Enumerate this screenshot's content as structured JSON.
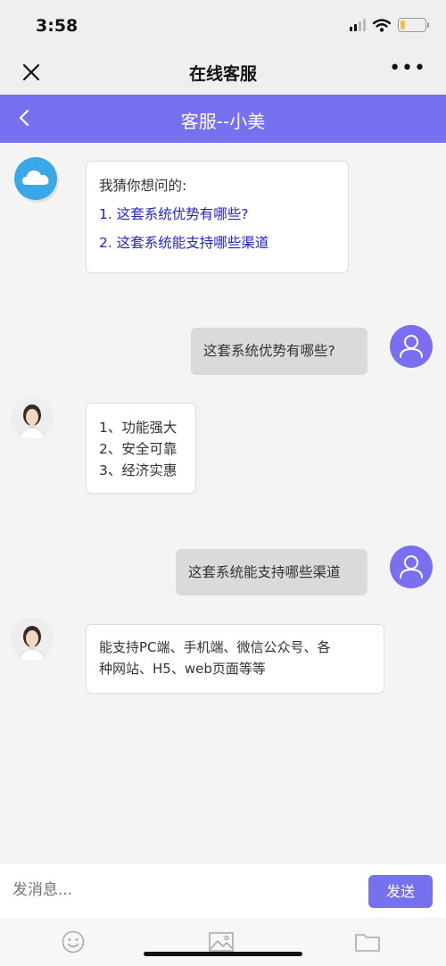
{
  "status": {
    "time": "3:58"
  },
  "nav": {
    "title": "在线客服",
    "more": "•••"
  },
  "chat": {
    "title": "客服--小美"
  },
  "messages": [
    {
      "from": "bot",
      "intro": "我猜你想问的:",
      "options": [
        "1.  这套系统优势有哪些?",
        "2.  这套系统能支持哪些渠道"
      ]
    },
    {
      "from": "user",
      "text": "这套系统优势有哪些?"
    },
    {
      "from": "agent",
      "lines": [
        "1、功能强大",
        "2、安全可靠",
        "3、经济实惠"
      ]
    },
    {
      "from": "user",
      "text": "这套系统能支持哪些渠道"
    },
    {
      "from": "agent",
      "lines": [
        "能支持PC端、手机端、微信公众号、各",
        "种网站、H5、web页面等等"
      ]
    }
  ],
  "input": {
    "placeholder": "发消息...",
    "send_label": "发送"
  },
  "toolbar": {
    "icons": [
      "smiley-icon",
      "image-icon",
      "folder-icon"
    ]
  },
  "colors": {
    "accent": "#7571f0",
    "link": "#2323c8",
    "user_avatar": "#7a6ff0",
    "bot_avatar": "#3aa7e6"
  }
}
